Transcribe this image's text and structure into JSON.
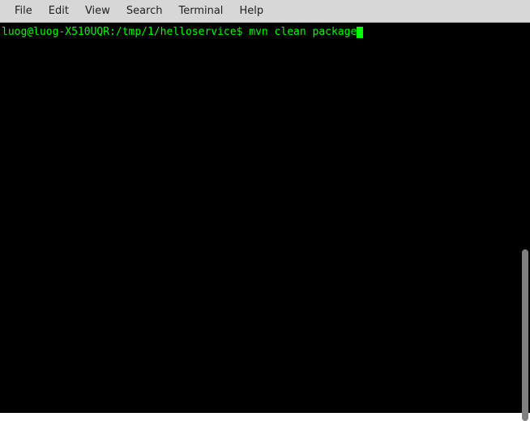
{
  "menubar": {
    "items": [
      {
        "label": "File"
      },
      {
        "label": "Edit"
      },
      {
        "label": "View"
      },
      {
        "label": "Search"
      },
      {
        "label": "Terminal"
      },
      {
        "label": "Help"
      }
    ]
  },
  "terminal": {
    "prompt": "luog@luog-X510UQR:/tmp/1/helloservice$ ",
    "command": "mvn clean package"
  }
}
